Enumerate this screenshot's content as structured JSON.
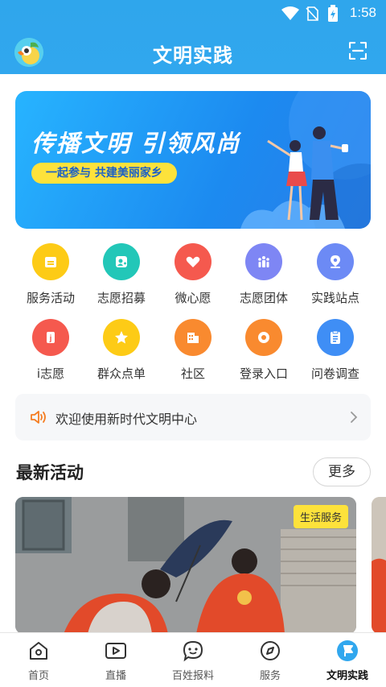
{
  "status_bar": {
    "time": "1:58"
  },
  "header": {
    "title": "文明实践"
  },
  "banner": {
    "headline": "传播文明 引领风尚",
    "tagline": "一起参与 共建美丽家乡"
  },
  "grid": {
    "items": [
      {
        "label": "服务活动",
        "icon": "calendar-icon",
        "color": "#fdcb16"
      },
      {
        "label": "志愿招募",
        "icon": "user-add-icon",
        "color": "#22c7b8"
      },
      {
        "label": "微心愿",
        "icon": "heart-icon",
        "color": "#f5594e"
      },
      {
        "label": "志愿团体",
        "icon": "group-icon",
        "color": "#7e86f4"
      },
      {
        "label": "实践站点",
        "icon": "location-icon",
        "color": "#6c8af5"
      },
      {
        "label": "i志愿",
        "icon": "volunteer-icon",
        "color": "#f5594e"
      },
      {
        "label": "群众点单",
        "icon": "star-icon",
        "color": "#fdcb16"
      },
      {
        "label": "社区",
        "icon": "building-icon",
        "color": "#f98a2f"
      },
      {
        "label": "登录入口",
        "icon": "login-icon",
        "color": "#f98a2f"
      },
      {
        "label": "问卷调查",
        "icon": "clipboard-icon",
        "color": "#3f8ef5"
      }
    ]
  },
  "notice": {
    "text": "欢迎使用新时代文明中心"
  },
  "latest": {
    "title": "最新活动",
    "more_label": "更多",
    "card_tag": "生活服务"
  },
  "bottom_nav": {
    "items": [
      {
        "label": "首页",
        "icon": "home-icon"
      },
      {
        "label": "直播",
        "icon": "video-icon"
      },
      {
        "label": "百姓报料",
        "icon": "chat-icon"
      },
      {
        "label": "服务",
        "icon": "compass-icon"
      },
      {
        "label": "文明实践",
        "icon": "flag-icon",
        "active": true
      }
    ]
  },
  "colors": {
    "primary": "#31a7ee",
    "accent_yellow": "#fde23b"
  }
}
